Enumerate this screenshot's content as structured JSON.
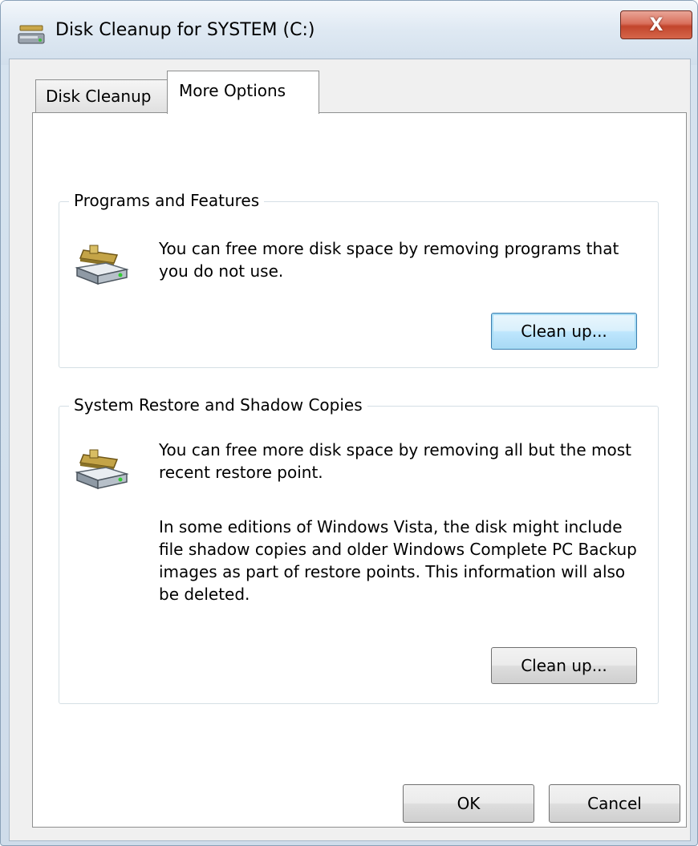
{
  "window": {
    "title": "Disk Cleanup for SYSTEM (C:)",
    "close_label": "X",
    "accent_color": "#3c7fb1"
  },
  "tabs": [
    {
      "label": "Disk Cleanup",
      "selected": false
    },
    {
      "label": "More Options",
      "selected": true
    }
  ],
  "sections": {
    "programs": {
      "title": "Programs and Features",
      "paragraphs": [
        "You can free more disk space by removing programs that you do not use."
      ],
      "button": "Clean up...",
      "icon": "disk-cleanup-drive-icon"
    },
    "restore": {
      "title": "System Restore and Shadow Copies",
      "paragraphs": [
        "You can free more disk space by removing all but the most recent restore point.",
        "In some editions of Windows Vista, the disk might include file shadow copies and older Windows Complete PC Backup images as part of restore points. This information will also be deleted."
      ],
      "button": "Clean up...",
      "icon": "disk-cleanup-drive-icon"
    }
  },
  "footer": {
    "ok_label": "OK",
    "cancel_label": "Cancel"
  }
}
